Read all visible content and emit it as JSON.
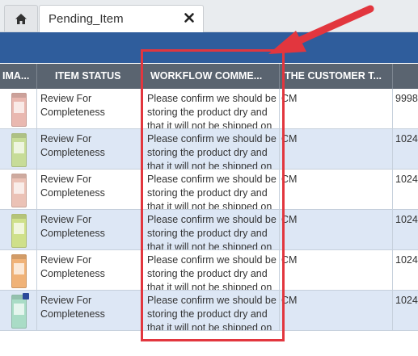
{
  "tabs": {
    "home_icon": "home-icon",
    "active_tab_label": "Pending_Item",
    "close_icon": "close-icon"
  },
  "grid": {
    "columns": [
      "IMA...",
      "ITEM STATUS",
      "WORKFLOW COMME...",
      "THE CUSTOMER T..."
    ],
    "rows": [
      {
        "thumb_color": "#e9b8b0",
        "status": "Review For Completeness",
        "workflow": "Please confirm we should be storing the product dry and that it will not be shipped on a",
        "customer": "CM",
        "id": "9998",
        "alt": false
      },
      {
        "thumb_color": "#c7dc98",
        "status": "Review For Completeness",
        "workflow": "Please confirm we should be storing the product dry and that it will not be shipped on a",
        "customer": "CM",
        "id": "1024",
        "alt": true
      },
      {
        "thumb_color": "#ebc2b6",
        "status": "Review For Completeness",
        "workflow": "Please confirm we should be storing the product dry and that it will not be shipped on a",
        "customer": "CM",
        "id": "1024",
        "alt": false
      },
      {
        "thumb_color": "#cfe08a",
        "status": "Review For Completeness",
        "workflow": "Please confirm we should be storing the product dry and that it will not be shipped on a",
        "customer": "CM",
        "id": "1024",
        "alt": true
      },
      {
        "thumb_color": "#f0b277",
        "status": "Review For Completeness",
        "workflow": "Please confirm we should be storing the product dry and that it will not be shipped on a",
        "customer": "CM",
        "id": "1024",
        "alt": false
      },
      {
        "thumb_color": "#a9dcc6",
        "status": "Review For Completeness",
        "workflow": "Please confirm we should be storing the product dry and that it will not be shipped on a",
        "customer": "CM",
        "id": "1024",
        "alt": true
      }
    ]
  },
  "colors": {
    "band": "#2f5d9c",
    "header": "#5a6470",
    "alt_row": "#dde7f5",
    "annotation": "#e2363e"
  }
}
